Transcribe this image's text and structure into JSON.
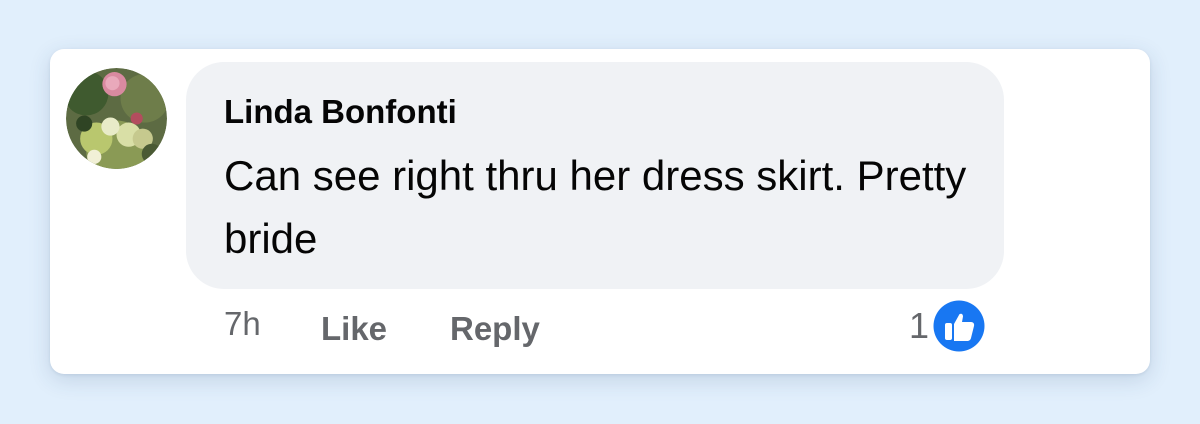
{
  "comment": {
    "author": "Linda Bonfonti",
    "text": "Can see right thru her dress skirt. Pretty bride",
    "timestamp": "7h",
    "actions": {
      "like_label": "Like",
      "reply_label": "Reply"
    },
    "reactions": {
      "count": "1",
      "icon": "thumbs-up-icon",
      "color": "#1877f2"
    }
  },
  "colors": {
    "page_background": "#e1effc",
    "bubble": "#f0f2f5",
    "meta_text": "#65676b",
    "reaction_blue": "#1877f2"
  }
}
